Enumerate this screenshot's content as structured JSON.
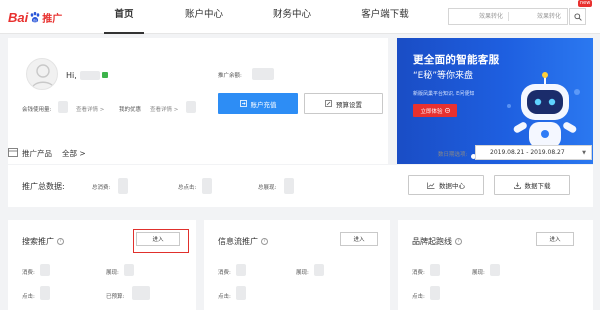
{
  "brand": {
    "logo_text": "Bai",
    "logo_suffix": "推广",
    "accent": "#e8312f"
  },
  "nav": {
    "items": [
      {
        "label": "首页",
        "active": true
      },
      {
        "label": "账户中心",
        "active": false
      },
      {
        "label": "财务中心",
        "active": false
      },
      {
        "label": "客户端下载",
        "active": false
      }
    ],
    "search": {
      "placeholder_left": "效果转化",
      "placeholder_right": "效果转化"
    },
    "new_badge": "new"
  },
  "account": {
    "greeting": "Hi,",
    "balance_label": "推广余额:",
    "account_status_label": "会钱使用量:",
    "view_detail_1": "查看详情 >",
    "my_discount_label": "我的优惠",
    "view_detail_2": "查看详情 >",
    "recharge_button": "账户充值",
    "budget_button": "预算设置"
  },
  "banner": {
    "title": "更全面的智能客服",
    "subtitle": "“E秘”等你来盘",
    "desc": "新版凤巢平台知识, E问便知",
    "cta": "立即体验",
    "accent": "#1e5fe0"
  },
  "products_header": {
    "title": "推广产品",
    "all_link": "全部 >",
    "date_label": "数日期选项:",
    "date_range": "2019.08.21 - 2019.08.27"
  },
  "total_data": {
    "label": "推广总数据:",
    "metrics": [
      "总消费:",
      "总点击:",
      "总展现:"
    ],
    "data_center_button": "数据中心",
    "download_button": "数据下载"
  },
  "product_cards": [
    {
      "name": "搜索推广",
      "enter": "进入",
      "rows": [
        [
          "消费:",
          "展现:"
        ],
        [
          "点击:",
          "已预算:"
        ]
      ]
    },
    {
      "name": "信息流推广",
      "enter": "进入",
      "rows": [
        [
          "消费:",
          "展现:"
        ],
        [
          "点击:",
          ""
        ]
      ]
    },
    {
      "name": "品牌起跑线",
      "enter": "进入",
      "rows": [
        [
          "消费:",
          "展现:"
        ],
        [
          "点击:",
          ""
        ]
      ]
    }
  ]
}
